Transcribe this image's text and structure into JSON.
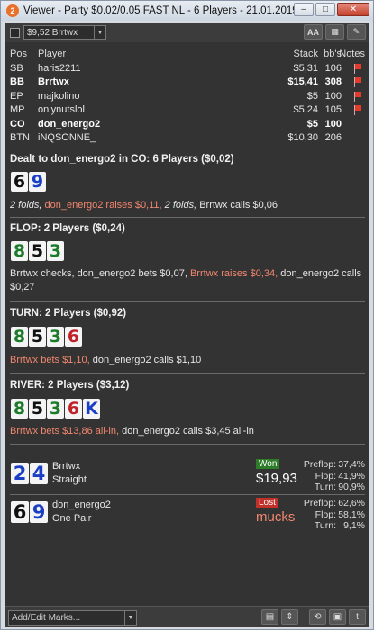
{
  "window": {
    "title": "Viewer - Party $0.02/0.05 FAST NL - 6 Players - 21.01.2019 11:42",
    "min_glyph": "–",
    "max_glyph": "□",
    "close_glyph": "✕"
  },
  "toolbar": {
    "player_select_value": "$9,52 Brrtwx",
    "font_button": "AA",
    "grid_button": "▦",
    "edit_button": "✎"
  },
  "players_table": {
    "headers": {
      "pos": "Pos",
      "player": "Player",
      "stack": "Stack",
      "bbs": "bb's",
      "notes": "Notes"
    },
    "rows": [
      {
        "pos": "SB",
        "player": "haris2211",
        "stack": "$5,31",
        "bbs": "106",
        "bold": false
      },
      {
        "pos": "BB",
        "player": "Brrtwx",
        "stack": "$15,41",
        "bbs": "308",
        "bold": true
      },
      {
        "pos": "EP",
        "player": "majkolino",
        "stack": "$5",
        "bbs": "100",
        "bold": false
      },
      {
        "pos": "MP",
        "player": "onlynutslol",
        "stack": "$5,24",
        "bbs": "105",
        "bold": false
      },
      {
        "pos": "CO",
        "player": "don_energo2",
        "stack": "$5",
        "bbs": "100",
        "bold": true
      },
      {
        "pos": "BTN",
        "player": "iNQSONNE_",
        "stack": "$10,30",
        "bbs": "206",
        "bold": false
      }
    ]
  },
  "preflop": {
    "title": "Dealt to don_energo2 in CO: 6 Players ($0,02)",
    "cards": [
      {
        "rank": "6",
        "suit": "spade"
      },
      {
        "rank": "9",
        "suit": "diamond"
      }
    ],
    "actions": {
      "a1": "2 folds,",
      "a2": "don_energo2 raises $0,11,",
      "a3": "2 folds,",
      "a4": "Brrtwx calls $0,06"
    }
  },
  "flop": {
    "title": "FLOP: 2 Players ($0,24)",
    "cards": [
      {
        "rank": "8",
        "suit": "club"
      },
      {
        "rank": "5",
        "suit": "spade"
      },
      {
        "rank": "3",
        "suit": "club"
      }
    ],
    "actions": {
      "a1": "Brrtwx checks, don_energo2 bets $0,07,",
      "a2": "Brrtwx raises $0,34,",
      "a3": "don_energo2 calls",
      "a4": "$0,27"
    }
  },
  "turn": {
    "title": "TURN: 2 Players ($0,92)",
    "cards": [
      {
        "rank": "8",
        "suit": "club"
      },
      {
        "rank": "5",
        "suit": "spade"
      },
      {
        "rank": "3",
        "suit": "club"
      },
      {
        "rank": "6",
        "suit": "heart"
      }
    ],
    "actions": {
      "a1": "Brrtwx bets $1,10,",
      "a2": "don_energo2 calls $1,10"
    }
  },
  "river": {
    "title": "RIVER: 2 Players ($3,12)",
    "cards": [
      {
        "rank": "8",
        "suit": "club"
      },
      {
        "rank": "5",
        "suit": "spade"
      },
      {
        "rank": "3",
        "suit": "club"
      },
      {
        "rank": "6",
        "suit": "heart"
      },
      {
        "rank": "K",
        "suit": "diamond"
      }
    ],
    "actions": {
      "a1": "Brrtwx bets $13,86 all-in,",
      "a2": "don_energo2 calls $3,45 all-in"
    }
  },
  "results": [
    {
      "cards": [
        {
          "rank": "2",
          "suit": "diamond"
        },
        {
          "rank": "4",
          "suit": "diamond"
        }
      ],
      "name": "Brrtwx",
      "hand": "Straight",
      "badge": "Won",
      "amount": "$19,93",
      "stats": [
        {
          "k": "Preflop:",
          "v": "37,4%"
        },
        {
          "k": "Flop:",
          "v": "41,9%"
        },
        {
          "k": "Turn:",
          "v": "90,9%"
        }
      ]
    },
    {
      "cards": [
        {
          "rank": "6",
          "suit": "spade"
        },
        {
          "rank": "9",
          "suit": "diamond"
        }
      ],
      "name": "don_energo2",
      "hand": "One Pair",
      "badge": "Lost",
      "amount": "mucks",
      "stats": [
        {
          "k": "Preflop:",
          "v": "62,6%"
        },
        {
          "k": "Flop:",
          "v": "58,1%"
        },
        {
          "k": "Turn:",
          "v": "9,1%"
        }
      ]
    }
  ],
  "bottombar": {
    "marks_value": "Add/Edit Marks...",
    "list_button": "▤",
    "spin_button": "⇕",
    "refresh_button": "⟲",
    "save_button": "▣",
    "twitter_button": "t"
  }
}
